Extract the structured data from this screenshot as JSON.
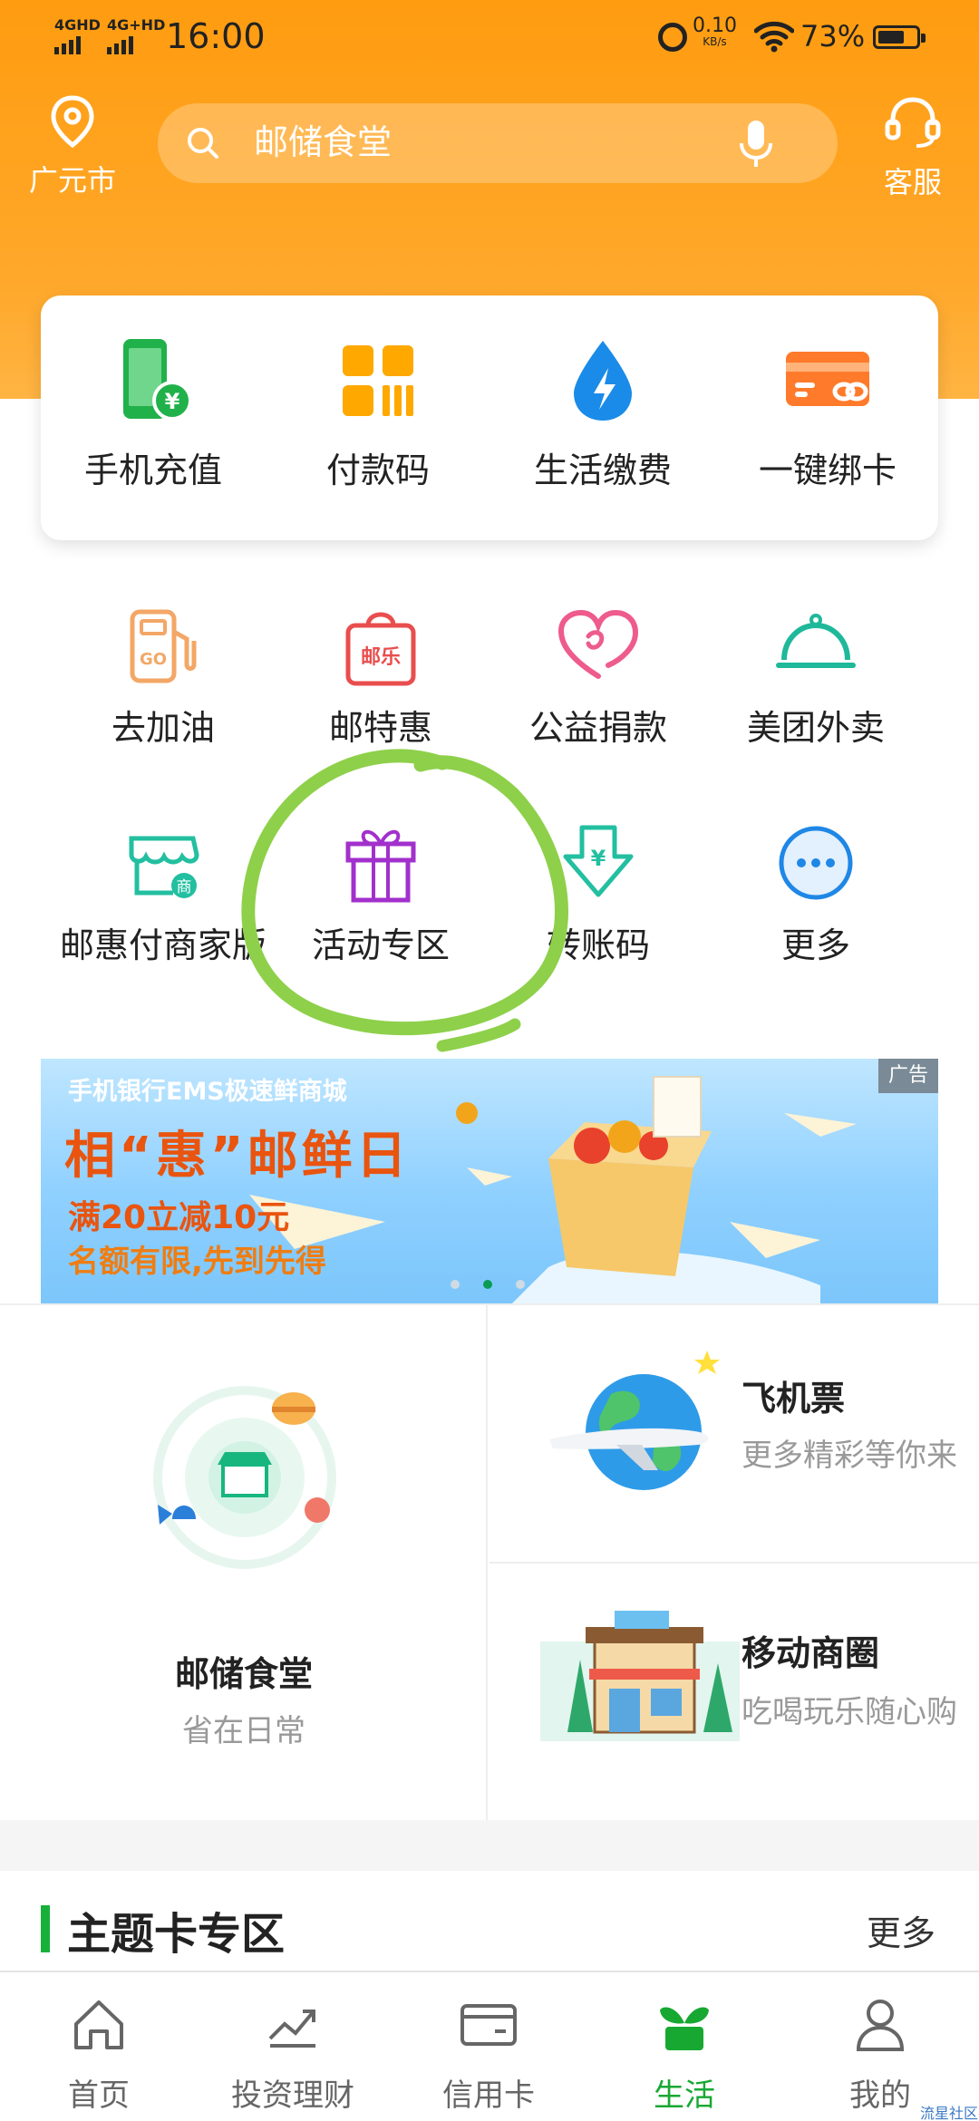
{
  "status_bar": {
    "network1": "4GHD",
    "network2": "4G+HD",
    "time": "16:00",
    "speed_value": "0.10",
    "speed_unit": "KB/s",
    "battery": "73%"
  },
  "header": {
    "location": "广元市",
    "search_placeholder": "邮储食堂",
    "service_label": "客服",
    "accent": "#ff9c10"
  },
  "quick_actions": [
    {
      "label": "手机充值",
      "icon": "phone-recharge-icon"
    },
    {
      "label": "付款码",
      "icon": "payment-code-icon"
    },
    {
      "label": "生活缴费",
      "icon": "utility-payment-icon"
    },
    {
      "label": "一键绑卡",
      "icon": "bind-card-icon"
    }
  ],
  "grid": [
    {
      "label": "去加油",
      "icon": "gas-station-icon"
    },
    {
      "label": "邮特惠",
      "icon": "shopping-bag-icon",
      "badge": "邮乐"
    },
    {
      "label": "公益捐款",
      "icon": "heart-icon"
    },
    {
      "label": "美团外卖",
      "icon": "service-bell-icon"
    },
    {
      "label": "邮惠付商家版",
      "icon": "merchant-store-icon",
      "badge": "商"
    },
    {
      "label": "活动专区",
      "icon": "gift-icon"
    },
    {
      "label": "转账码",
      "icon": "transfer-code-icon"
    },
    {
      "label": "更多",
      "icon": "more-icon"
    }
  ],
  "banner": {
    "top_text": "手机银行EMS极速鲜商城",
    "title": "相“惠”邮鲜日",
    "line1": "满20立减10元",
    "line2": "名额有限,先到先得",
    "ad_label": "广告",
    "active_dot": 1,
    "dot_count": 3
  },
  "services": {
    "canteen": {
      "name": "邮储食堂",
      "sub": "省在日常"
    },
    "flights": {
      "name": "飞机票",
      "sub": "更多精彩等你来"
    },
    "mobile_mall": {
      "name": "移动商圈",
      "sub": "吃喝玩乐随心购"
    }
  },
  "theme_section": {
    "title": "主题卡专区",
    "more": "更多"
  },
  "tabs": [
    {
      "label": "首页",
      "icon": "home-icon"
    },
    {
      "label": "投资理财",
      "icon": "investment-icon"
    },
    {
      "label": "信用卡",
      "icon": "credit-card-icon"
    },
    {
      "label": "生活",
      "icon": "life-sprout-icon",
      "active": true
    },
    {
      "label": "我的",
      "icon": "profile-icon"
    }
  ],
  "watermark": "流星社区",
  "colors": {
    "brand_orange": "#ff9c10",
    "active_green": "#17a832",
    "annotation_green": "#8ed04a"
  }
}
